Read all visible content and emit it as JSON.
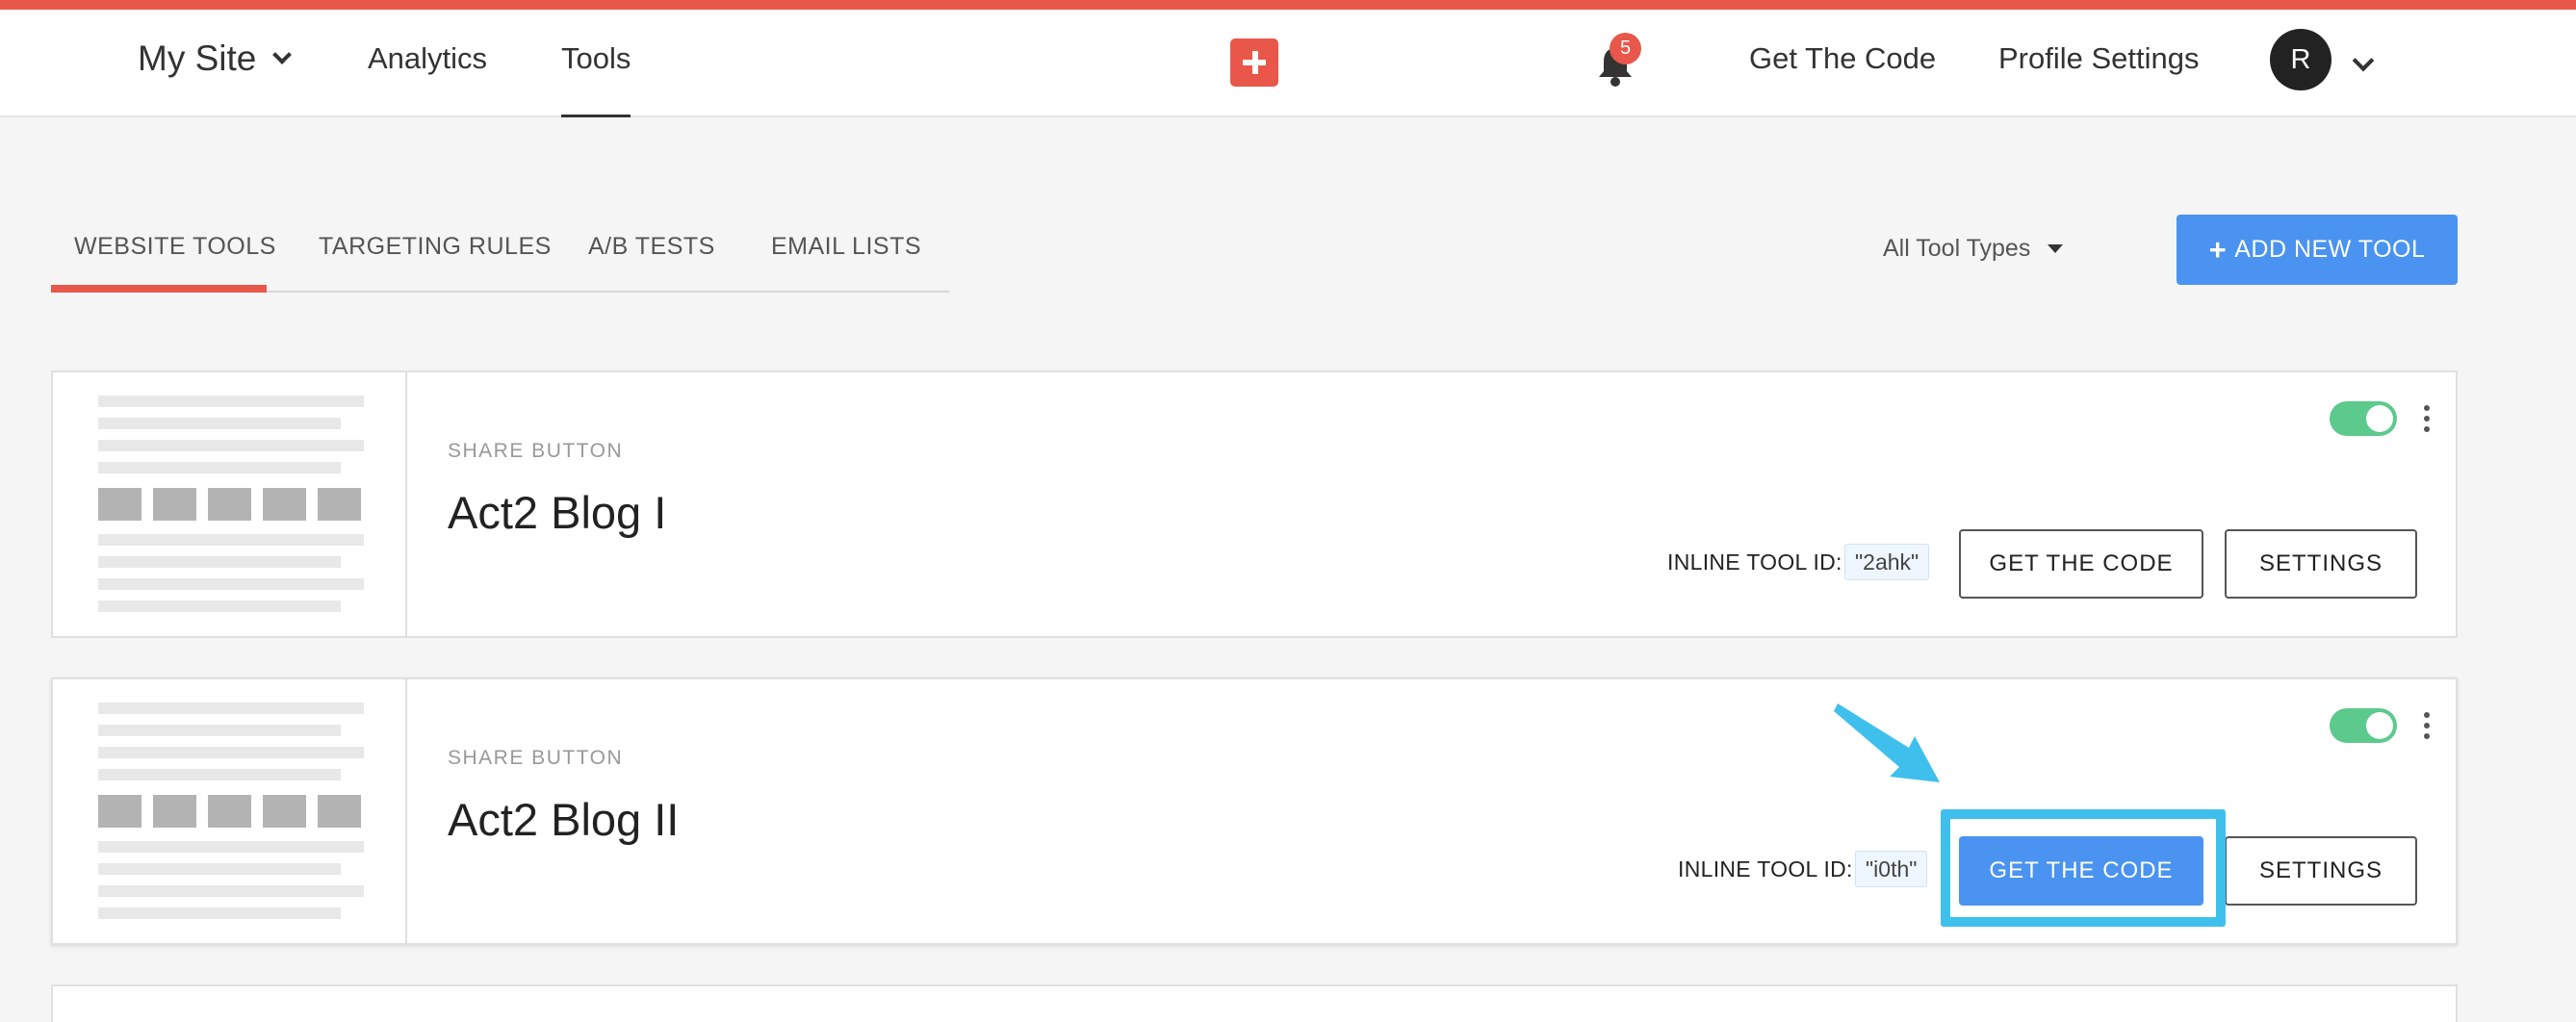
{
  "colors": {
    "accent": "#e8574a",
    "primary": "#4a93f0",
    "toggle_on": "#5cc98d",
    "highlight": "#3fc0ec"
  },
  "navbar": {
    "site_selector": "My Site",
    "links": [
      "Analytics",
      "Tools"
    ],
    "active_link": "Tools",
    "add_icon": "plus-icon",
    "notifications_icon": "bell-icon",
    "notification_count": "5",
    "get_the_code": "Get The Code",
    "profile_settings": "Profile Settings",
    "avatar_initial": "R"
  },
  "tabs": {
    "items": [
      "WEBSITE TOOLS",
      "TARGETING RULES",
      "A/B TESTS",
      "EMAIL LISTS"
    ],
    "active": "WEBSITE TOOLS"
  },
  "filter": {
    "selected": "All Tool Types"
  },
  "add_tool": {
    "icon": "+",
    "label": "ADD NEW TOOL"
  },
  "tools": [
    {
      "type": "SHARE BUTTON",
      "title": "Act2 Blog I",
      "enabled": true,
      "inline_id_label": "INLINE TOOL ID:",
      "inline_id": "\"2ahk\"",
      "get_code_label": "GET THE CODE",
      "settings_label": "SETTINGS"
    },
    {
      "type": "SHARE BUTTON",
      "title": "Act2 Blog II",
      "enabled": true,
      "inline_id_label": "INLINE TOOL ID:",
      "inline_id": "\"i0th\"",
      "get_code_label": "GET THE CODE",
      "settings_label": "SETTINGS",
      "highlighted": true
    }
  ]
}
